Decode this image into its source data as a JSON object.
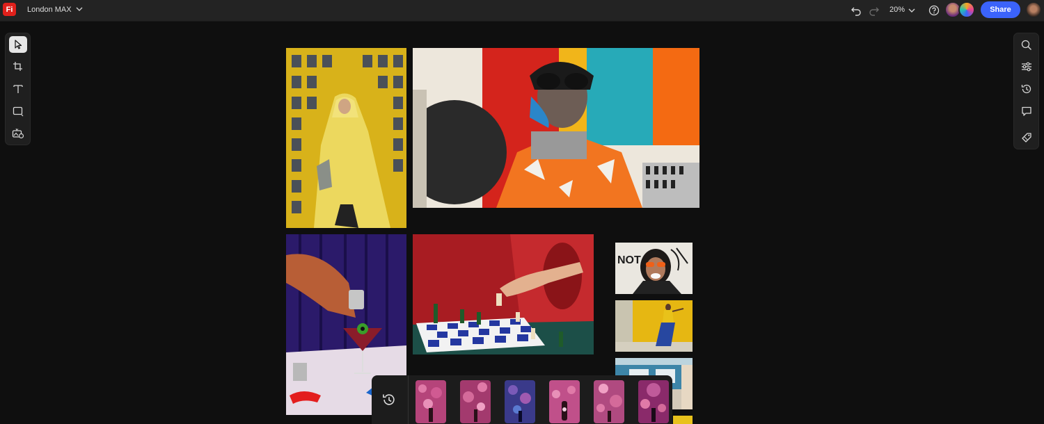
{
  "app": {
    "logo_text": "Fi",
    "logo_color": "#e0201b"
  },
  "document": {
    "title": "London MAX"
  },
  "header": {
    "zoom": "20%",
    "share_label": "Share",
    "accent_color": "#3b63fb",
    "icons": [
      "undo-icon",
      "redo-icon",
      "chevron-down-icon",
      "help-icon"
    ]
  },
  "left_toolbar": {
    "tools": [
      "select-tool",
      "crop-tool",
      "text-tool",
      "shape-tool",
      "generate-tool"
    ],
    "active_tool": "select-tool"
  },
  "right_toolbar": {
    "tools": [
      "search-icon",
      "adjustments-icon",
      "history-icon",
      "comment-icon",
      "tag-icon"
    ]
  },
  "canvas": {
    "images": [
      "yellow-coat-photo",
      "collage-sunglasses-photo",
      "cocktail-eyeball-photo",
      "chess-hand-photo",
      "orange-glasses-woman-photo",
      "yellow-wall-woman-photo",
      "blue-building-photo",
      "partial-yellow-photo"
    ]
  },
  "variations_bar": {
    "thumbnail_count": 6
  }
}
